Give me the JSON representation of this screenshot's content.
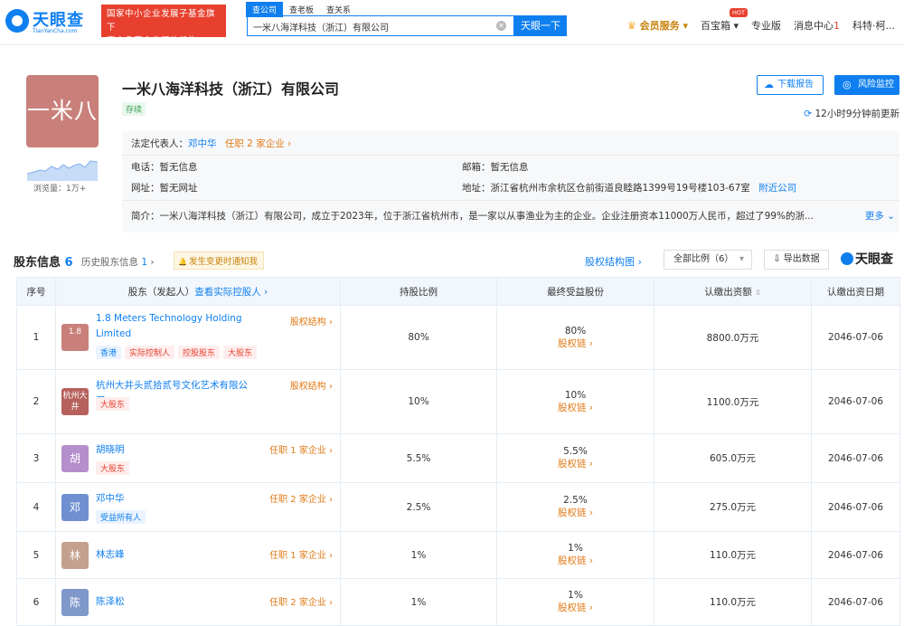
{
  "header": {
    "logo_text": "天眼查",
    "logo_sub": "TianYanCha.com",
    "banner_line1": "国家中小企业发展子基金旗下",
    "banner_line2": "官方备案企业征信机构",
    "search_tabs": [
      "查公司",
      "查老板",
      "查关系"
    ],
    "search_value": "一米八海洋科技（浙江）有限公司",
    "search_button": "天眼一下",
    "nav": {
      "vip": "会员服务",
      "treasure": "百宝箱",
      "hot": "HOT",
      "pro": "专业版",
      "messages": "消息中心",
      "message_count": "1",
      "user": "科特·柯..."
    }
  },
  "company": {
    "avatar_text": "一米八",
    "name": "一米八海洋科技（浙江）有限公司",
    "status": "存续",
    "views": "浏览量：1万+",
    "download_btn": "下载报告",
    "monitor_btn": "风险监控",
    "update_text": "12小时9分钟前更新",
    "legal_rep_label": "法定代表人：",
    "legal_rep": "邓中华",
    "legal_rep_jobs": "任职 2 家企业 ›",
    "phone": "电话：暂无信息",
    "email": "邮箱：暂无信息",
    "website": "网址：暂无网址",
    "address": "地址：浙江省杭州市余杭区仓前街道良睦路1399号19号楼103-67室",
    "nearby": "附近公司",
    "intro": "简介：一米八海洋科技（浙江）有限公司，成立于2023年，位于浙江省杭州市，是一家以从事渔业为主的企业。企业注册资本11000万人民币，超过了99%的浙...",
    "more": "更多"
  },
  "shareholders": {
    "title": "股东信息",
    "count": "6",
    "history": "历史股东信息",
    "history_count": "1",
    "notify": "发生变更时通知我",
    "structure_link": "股权结构图 ›",
    "ratio_select": "全部比例（6）",
    "export": "导出数据",
    "tyc": "天眼查",
    "columns": {
      "no": "序号",
      "holder": "股东（发起人）",
      "holder_link": "查看实际控股人 ›",
      "ratio": "持股比例",
      "final": "最终受益股份",
      "capital": "认缴出资额",
      "date": "认缴出资日期"
    },
    "chain_label": "股权链 ›",
    "rows": [
      {
        "no": "1",
        "avatar": "1.8",
        "name": "1.8 Meters Technology Holding Limited",
        "right": "股权结构 ›",
        "tags": [
          "香港",
          "实际控制人",
          "控股股东",
          "大股东"
        ],
        "ratio": "80%",
        "final": "80%",
        "capital": "8800.0万元",
        "date": "2046-07-06"
      },
      {
        "no": "2",
        "avatar": "杭州大井",
        "name": "杭州大井头贰拾贰号文化艺术有限公司",
        "right": "股权结构 ›",
        "tags": [
          "大股东"
        ],
        "ratio": "10%",
        "final": "10%",
        "capital": "1100.0万元",
        "date": "2046-07-06"
      },
      {
        "no": "3",
        "avatar": "胡",
        "name": "胡晓明",
        "right": "任职 1 家企业 ›",
        "tags": [
          "大股东"
        ],
        "ratio": "5.5%",
        "final": "5.5%",
        "capital": "605.0万元",
        "date": "2046-07-06"
      },
      {
        "no": "4",
        "avatar": "邓",
        "name": "邓中华",
        "right": "任职 2 家企业 ›",
        "tags": [
          "受益所有人"
        ],
        "ratio": "2.5%",
        "final": "2.5%",
        "capital": "275.0万元",
        "date": "2046-07-06"
      },
      {
        "no": "5",
        "avatar": "林",
        "name": "林志峰",
        "right": "任职 1 家企业 ›",
        "tags": [],
        "ratio": "1%",
        "final": "1%",
        "capital": "110.0万元",
        "date": "2046-07-06"
      },
      {
        "no": "6",
        "avatar": "陈",
        "name": "陈泽松",
        "right": "任职 2 家企业 ›",
        "tags": [],
        "ratio": "1%",
        "final": "1%",
        "capital": "110.0万元",
        "date": "2046-07-06"
      }
    ]
  },
  "colors": {
    "brand": "#0f7ff0",
    "avatar_1": "#c9807a",
    "avatar_2": "#b6615c",
    "avatar_3": "#b58fcb",
    "avatar_4": "#6f8fd1",
    "avatar_5": "#c4a08e",
    "avatar_6": "#7f97c9"
  }
}
